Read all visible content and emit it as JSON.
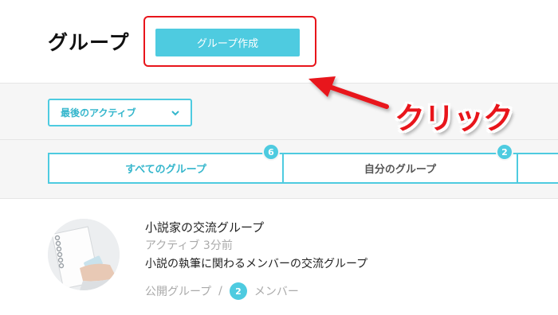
{
  "header": {
    "title": "グループ",
    "create_button_label": "グループ作成"
  },
  "filter": {
    "selected": "最後のアクティブ"
  },
  "tabs": [
    {
      "label": "すべてのグループ",
      "count": "6"
    },
    {
      "label": "自分のグループ",
      "count": "2"
    }
  ],
  "annotation": {
    "label": "クリック",
    "color": "#e8151b"
  },
  "groups": [
    {
      "name": "小説家の交流グループ",
      "activity": "アクティブ 3分前",
      "description": "小説の執筆に関わるメンバーの交流グループ",
      "visibility": "公開グループ",
      "separator": "/",
      "member_count": "2",
      "member_label": "メンバー"
    }
  ],
  "colors": {
    "accent": "#4ecbe0",
    "band_background": "#f6f6f6"
  }
}
